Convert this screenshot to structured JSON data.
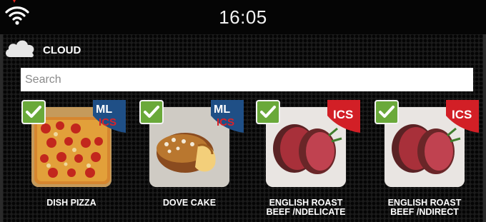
{
  "status": {
    "time": "16:05"
  },
  "source": {
    "label": "CLOUD"
  },
  "search": {
    "placeholder": "Search",
    "value": ""
  },
  "recipes": [
    {
      "name": "DISH PIZZA",
      "badge": [
        "ML",
        "ICS"
      ],
      "checked": true
    },
    {
      "name": "DOVE CAKE",
      "badge": [
        "ML",
        "ICS"
      ],
      "checked": true
    },
    {
      "name": "ENGLISH ROAST BEEF /NDELICATE",
      "badge": [
        "ICS"
      ],
      "checked": true
    },
    {
      "name": "ENGLISH ROAST BEEF /NDIRECT",
      "badge": [
        "ICS"
      ],
      "checked": true
    }
  ],
  "colors": {
    "ml_badge": "#1f4f86",
    "ics_badge_blue": "#c0242a",
    "ics_badge_red": "#d21f26",
    "check": "#6aa93a"
  }
}
